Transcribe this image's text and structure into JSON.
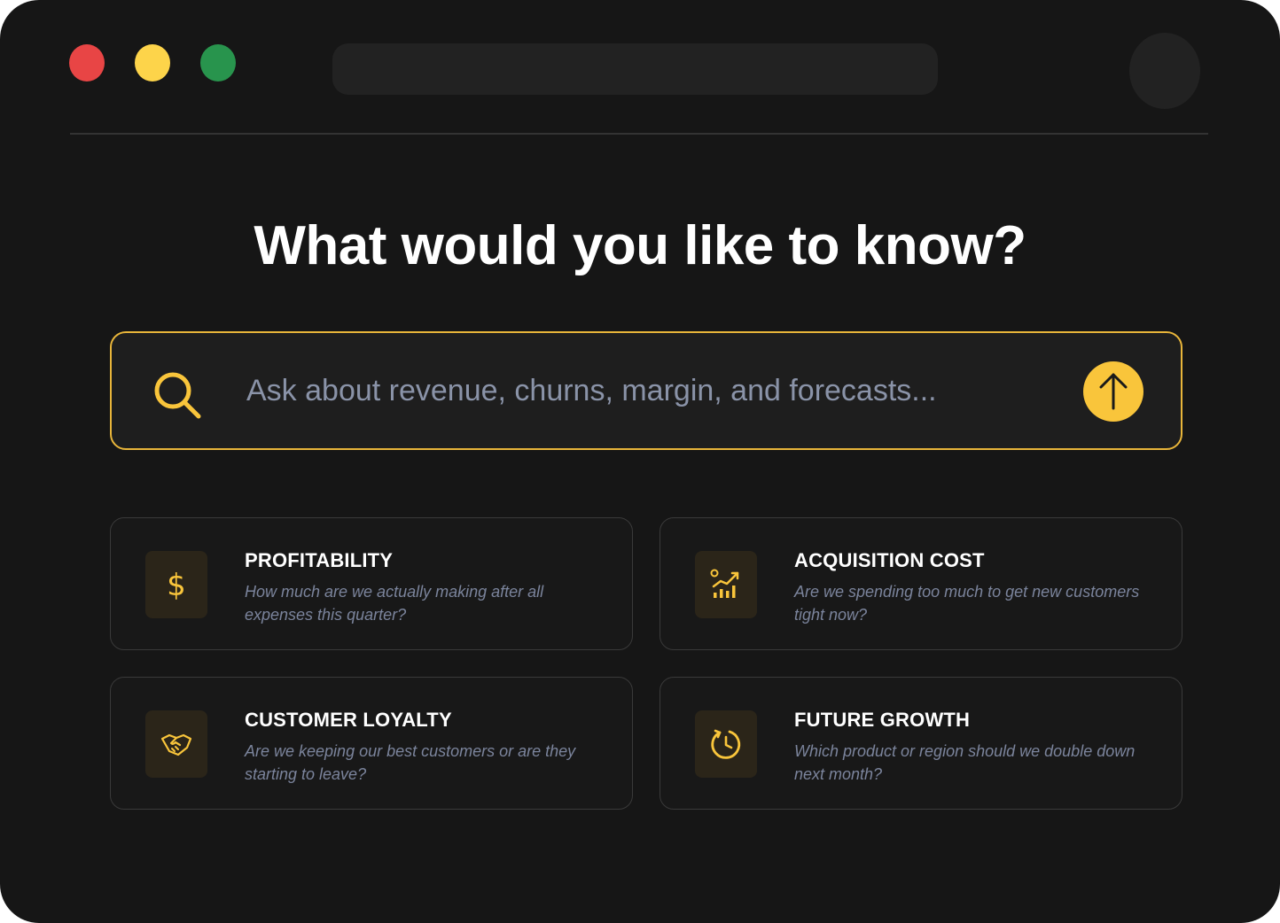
{
  "window": {
    "controls": [
      {
        "name": "close",
        "color": "#e84545"
      },
      {
        "name": "minimize",
        "color": "#fdd44a"
      },
      {
        "name": "maximize",
        "color": "#28944d"
      }
    ]
  },
  "headline": "What would you like to know?",
  "search": {
    "placeholder": "Ask about revenue, churns, margin, and forecasts...",
    "accent_color": "#f9c53b",
    "icon": "search-icon",
    "submit_icon": "arrow-up-icon"
  },
  "cards": [
    {
      "title": "PROFITABILITY",
      "description": "How much are we actually making after all expenses this quarter?",
      "icon": "dollar-icon"
    },
    {
      "title": "ACQUISITION COST",
      "description": "Are we spending too much to get new customers tight now?",
      "icon": "chart-growth-icon"
    },
    {
      "title": "CUSTOMER LOYALTY",
      "description": "Are we keeping our best customers or are they starting to leave?",
      "icon": "handshake-icon"
    },
    {
      "title": "FUTURE GROWTH",
      "description": "Which product or region should we double down next month?",
      "icon": "clock-refresh-icon"
    }
  ]
}
